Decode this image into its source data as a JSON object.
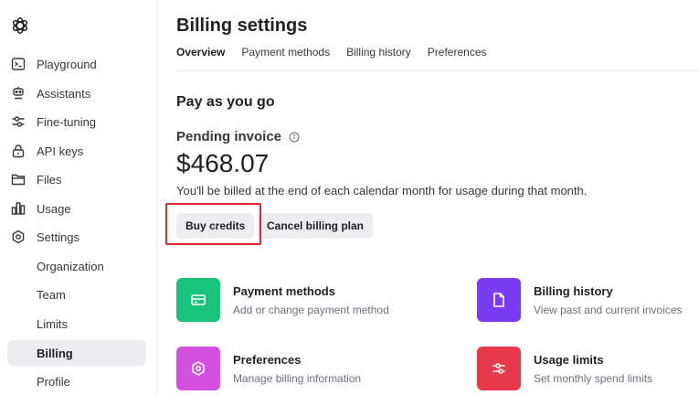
{
  "sidebar": {
    "items": [
      {
        "label": "Playground",
        "icon": "terminal-icon"
      },
      {
        "label": "Assistants",
        "icon": "robot-icon"
      },
      {
        "label": "Fine-tuning",
        "icon": "tune-icon"
      },
      {
        "label": "API keys",
        "icon": "lock-icon"
      },
      {
        "label": "Files",
        "icon": "folder-icon"
      },
      {
        "label": "Usage",
        "icon": "bar-chart-icon"
      },
      {
        "label": "Settings",
        "icon": "gear-icon"
      }
    ],
    "sub_items": [
      {
        "label": "Organization"
      },
      {
        "label": "Team"
      },
      {
        "label": "Limits"
      },
      {
        "label": "Billing",
        "active": true
      },
      {
        "label": "Profile"
      }
    ]
  },
  "header": {
    "title": "Billing settings",
    "tabs": [
      {
        "label": "Overview",
        "active": true
      },
      {
        "label": "Payment methods"
      },
      {
        "label": "Billing history"
      },
      {
        "label": "Preferences"
      }
    ]
  },
  "overview": {
    "section_title": "Pay as you go",
    "pending_label": "Pending invoice",
    "amount": "$468.07",
    "billed_text": "You'll be billed at the end of each calendar month for usage during that month.",
    "buy_credits_label": "Buy credits",
    "cancel_plan_label": "Cancel billing plan"
  },
  "cards": [
    {
      "title": "Payment methods",
      "subtitle": "Add or change payment method",
      "color": "#19c37d",
      "icon": "credit-card-icon"
    },
    {
      "title": "Billing history",
      "subtitle": "View past and current invoices",
      "color": "#7a3cf0",
      "icon": "document-icon"
    },
    {
      "title": "Preferences",
      "subtitle": "Manage billing information",
      "color": "#d24fe0",
      "icon": "gear-icon"
    },
    {
      "title": "Usage limits",
      "subtitle": "Set monthly spend limits",
      "color": "#e6394a",
      "icon": "sliders-icon"
    }
  ],
  "colors": {
    "highlight": "#e0242a",
    "active_bg": "#ececf1"
  }
}
